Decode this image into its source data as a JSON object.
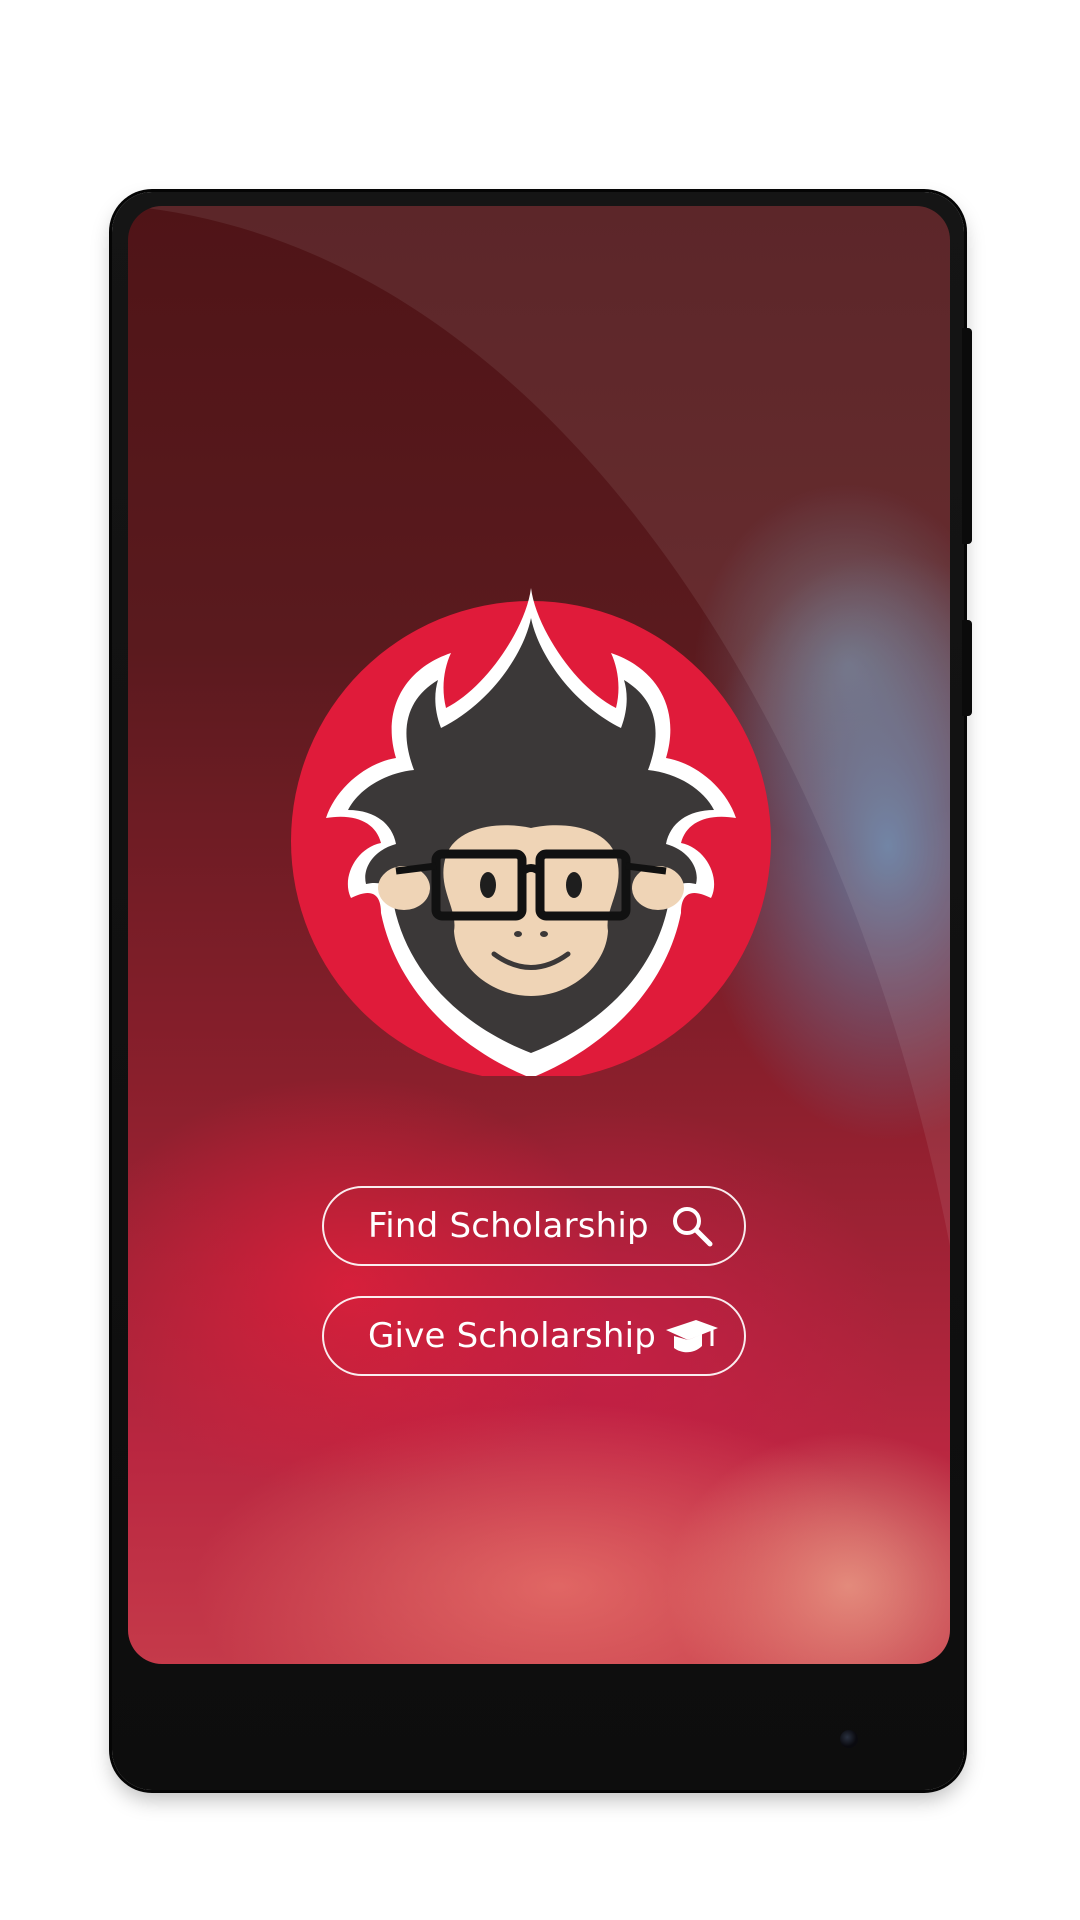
{
  "actions": {
    "find_label": "Find Scholarship",
    "give_label": "Give Scholarship"
  },
  "icons": {
    "find": "search-icon",
    "give": "graduation-cap-icon",
    "logo": "monkey-mascot-logo"
  },
  "colors": {
    "brand_red": "#e01b3a",
    "mascot_dark": "#3b3838",
    "face_skin": "#efd4b6",
    "button_border": "#ffffff"
  }
}
